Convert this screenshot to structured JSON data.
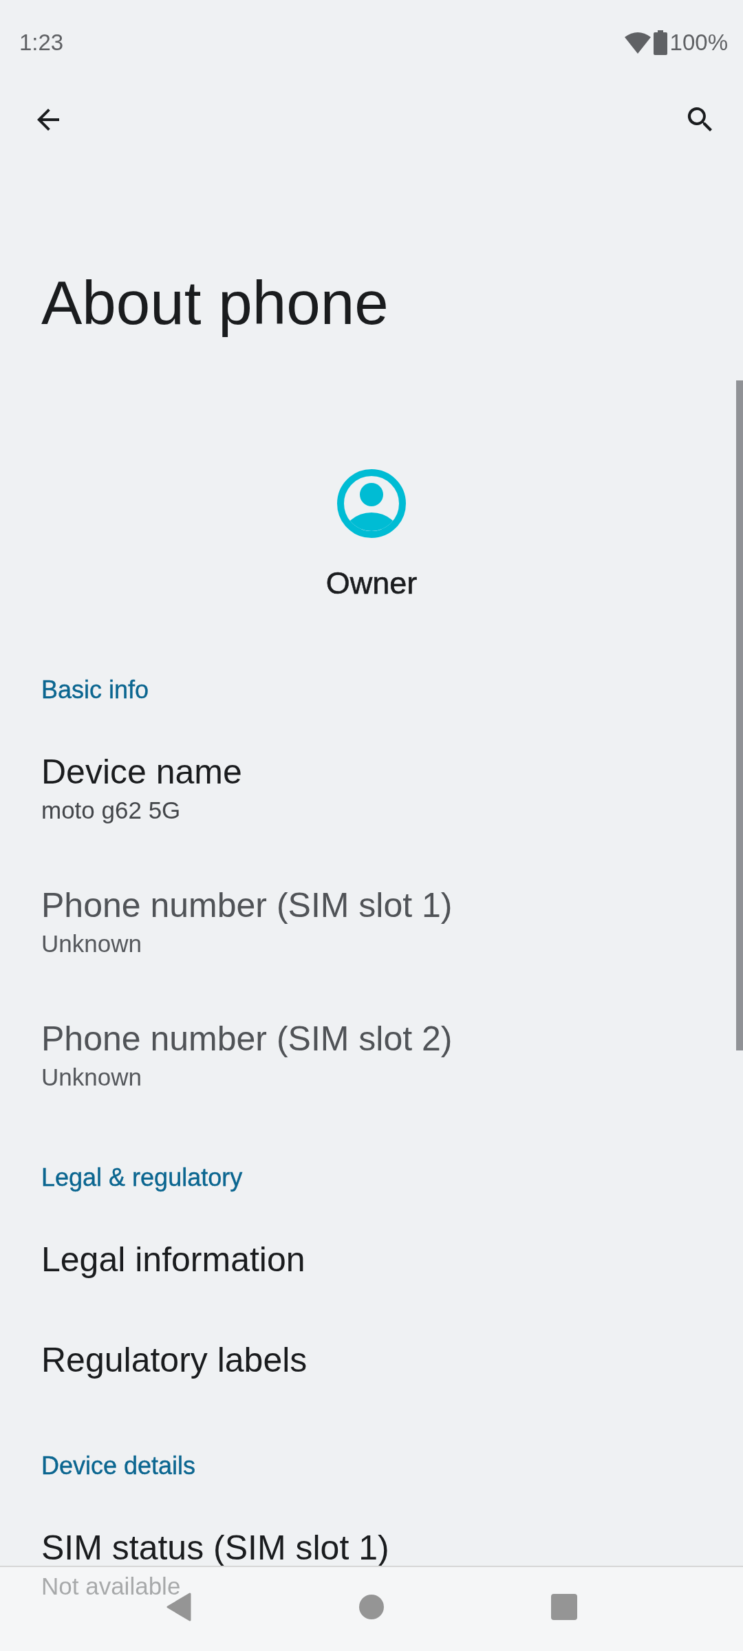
{
  "status_bar": {
    "time": "1:23",
    "battery": "100%"
  },
  "page": {
    "title": "About phone"
  },
  "profile": {
    "name": "Owner"
  },
  "list": [
    {
      "kind": "header",
      "title": "Basic info"
    },
    {
      "kind": "item",
      "title": "Device name",
      "summary": "moto g62 5G",
      "disabled": false
    },
    {
      "kind": "item",
      "title": "Phone number (SIM slot 1)",
      "summary": "Unknown",
      "disabled": true
    },
    {
      "kind": "item",
      "title": "Phone number (SIM slot 2)",
      "summary": "Unknown",
      "disabled": true
    },
    {
      "kind": "header",
      "title": "Legal & regulatory"
    },
    {
      "kind": "item",
      "title": "Legal information",
      "disabled": false
    },
    {
      "kind": "item",
      "title": "Regulatory labels",
      "disabled": false
    },
    {
      "kind": "header",
      "title": "Device details"
    },
    {
      "kind": "item",
      "title": "SIM status (SIM slot 1)",
      "summary": "Not available",
      "disabled": false
    }
  ]
}
